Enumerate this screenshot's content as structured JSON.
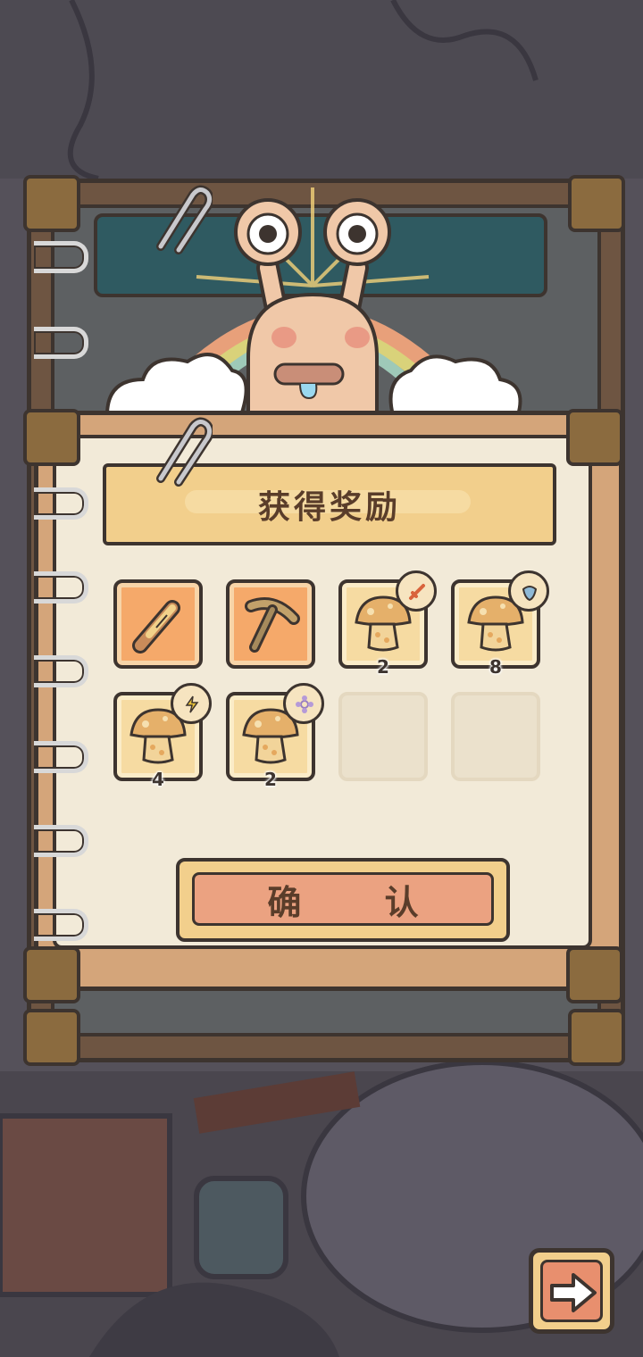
{
  "dialog": {
    "title": "获得奖励",
    "confirm_label": "确  认"
  },
  "rewards": [
    {
      "icon": "corn-cob-icon",
      "qty": "",
      "style": "orange"
    },
    {
      "icon": "pickaxe-icon",
      "qty": "",
      "style": "orange"
    },
    {
      "icon": "mushroom-icon",
      "qty": "2",
      "badge": "sword-badge-icon",
      "style": "light"
    },
    {
      "icon": "mushroom-icon",
      "qty": "8",
      "badge": "shield-badge-icon",
      "style": "light"
    },
    {
      "icon": "mushroom-icon",
      "qty": "4",
      "badge": "lightning-badge-icon",
      "style": "light"
    },
    {
      "icon": "mushroom-icon",
      "qty": "2",
      "badge": "flower-badge-icon",
      "style": "light"
    },
    {
      "icon": "",
      "qty": "",
      "style": "empty"
    },
    {
      "icon": "",
      "qty": "",
      "style": "empty"
    }
  ],
  "colors": {
    "panel_brown": "#d4a57a",
    "paper": "#f2ead8",
    "title_gold": "#f2cf8c",
    "button_salmon": "#eba281",
    "outline": "#3d342f"
  }
}
